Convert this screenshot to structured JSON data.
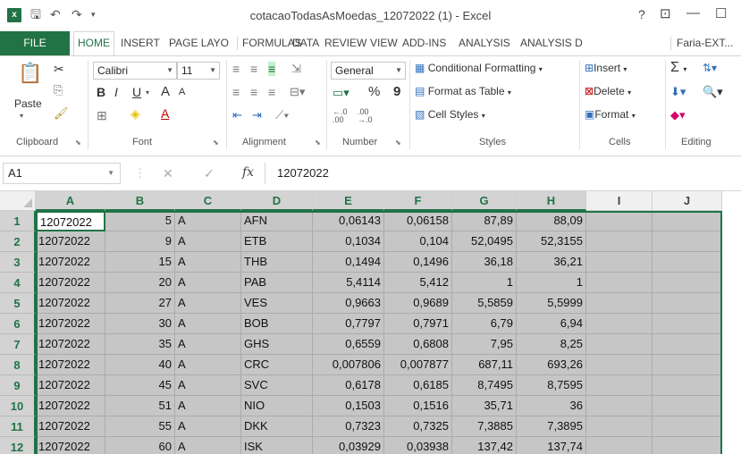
{
  "window": {
    "title": "cotacaoTodasAsMoedas_12072022 (1) - Excel",
    "help": "?",
    "restore_glyph": "⊡",
    "minimize_glyph": "—",
    "maximize_glyph": "☐"
  },
  "tabs": [
    "FILE",
    "HOME",
    "INSERT",
    "PAGE LAYO",
    "FORMULAS",
    "DATA",
    "REVIEW",
    "VIEW",
    "ADD-INS",
    "ANALYSIS",
    "ANALYSIS D"
  ],
  "account": "Faria-EXT... ▾",
  "ribbon": {
    "clipboard": {
      "paste": "Paste",
      "label": "Clipboard"
    },
    "font": {
      "name": "Calibri",
      "size": "11",
      "bold": "B",
      "italic": "I",
      "underline": "U",
      "grow": "A",
      "shrink": "A",
      "label": "Font"
    },
    "alignment": {
      "label": "Alignment"
    },
    "number": {
      "format": "General",
      "percent": "%",
      "comma": "9",
      "label": "Number"
    },
    "styles": {
      "conditional": "Conditional Formatting",
      "table": "Format as Table",
      "cell_styles": "Cell Styles",
      "label": "Styles"
    },
    "cells": {
      "insert": "Insert",
      "delete": "Delete",
      "format": "Format",
      "label": "Cells"
    },
    "editing": {
      "label": "Editing"
    }
  },
  "formula_bar": {
    "name_box": "A1",
    "fx": "fx",
    "value": "12072022"
  },
  "sheet": {
    "columns": [
      "A",
      "B",
      "C",
      "D",
      "E",
      "F",
      "G",
      "H",
      "I",
      "J"
    ],
    "rows": [
      [
        "12072022",
        "5",
        "A",
        "AFN",
        "0,06143",
        "0,06158",
        "87,89",
        "88,09",
        "",
        ""
      ],
      [
        "12072022",
        "9",
        "A",
        "ETB",
        "0,1034",
        "0,104",
        "52,0495",
        "52,3155",
        "",
        ""
      ],
      [
        "12072022",
        "15",
        "A",
        "THB",
        "0,1494",
        "0,1496",
        "36,18",
        "36,21",
        "",
        ""
      ],
      [
        "12072022",
        "20",
        "A",
        "PAB",
        "5,4114",
        "5,412",
        "1",
        "1",
        "",
        ""
      ],
      [
        "12072022",
        "27",
        "A",
        "VES",
        "0,9663",
        "0,9689",
        "5,5859",
        "5,5999",
        "",
        ""
      ],
      [
        "12072022",
        "30",
        "A",
        "BOB",
        "0,7797",
        "0,7971",
        "6,79",
        "6,94",
        "",
        ""
      ],
      [
        "12072022",
        "35",
        "A",
        "GHS",
        "0,6559",
        "0,6808",
        "7,95",
        "8,25",
        "",
        ""
      ],
      [
        "12072022",
        "40",
        "A",
        "CRC",
        "0,007806",
        "0,007877",
        "687,11",
        "693,26",
        "",
        ""
      ],
      [
        "12072022",
        "45",
        "A",
        "SVC",
        "0,6178",
        "0,6185",
        "8,7495",
        "8,7595",
        "",
        ""
      ],
      [
        "12072022",
        "51",
        "A",
        "NIO",
        "0,1503",
        "0,1516",
        "35,71",
        "36",
        "",
        ""
      ],
      [
        "12072022",
        "55",
        "A",
        "DKK",
        "0,7323",
        "0,7325",
        "7,3885",
        "7,3895",
        "",
        ""
      ],
      [
        "12072022",
        "60",
        "A",
        "ISK",
        "0,03929",
        "0,03938",
        "137,42",
        "137,74",
        "",
        ""
      ]
    ]
  },
  "colors": {
    "accent": "#217346",
    "selection": "#c6c6c6"
  }
}
